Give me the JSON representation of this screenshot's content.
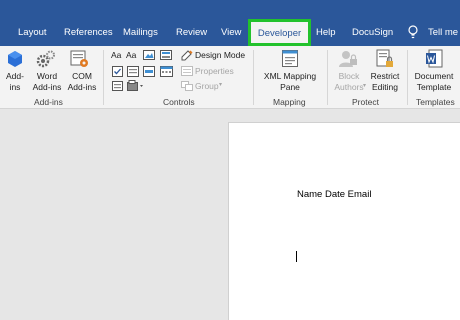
{
  "tabs": {
    "layout": "Layout",
    "references": "References",
    "mailings": "Mailings",
    "review": "Review",
    "view": "View",
    "developer": "Developer",
    "help": "Help",
    "docusign": "DocuSign",
    "tell_me": "Tell me"
  },
  "ribbon": {
    "addins_group": {
      "label": "Add-ins",
      "addins_btn_line1": "Add-",
      "addins_btn_line2": "ins",
      "word_addins_line1": "Word",
      "word_addins_line2": "Add-ins",
      "com_addins_line1": "COM",
      "com_addins_line2": "Add-ins"
    },
    "controls_group": {
      "label": "Controls",
      "design_mode": "Design Mode",
      "properties": "Properties",
      "group": "Group"
    },
    "mapping_group": {
      "label": "Mapping",
      "xml_line1": "XML Mapping",
      "xml_line2": "Pane"
    },
    "protect_group": {
      "label": "Protect",
      "block_line1": "Block",
      "block_line2": "Authors",
      "restrict_line1": "Restrict",
      "restrict_line2": "Editing"
    },
    "templates_group": {
      "label": "Templates",
      "doc_template_line1": "Document",
      "doc_template_line2": "Template"
    }
  },
  "document": {
    "text": "Name Date Email"
  },
  "colors": {
    "tabbar": "#2b579a",
    "highlight": "#22c22c",
    "ribbon": "#f3f3f3"
  }
}
